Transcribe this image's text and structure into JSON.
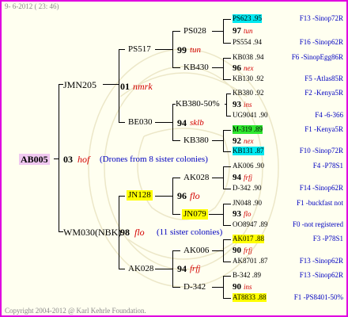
{
  "header": {
    "date": "9-  6-2012 ( 23: 46)"
  },
  "footer": {
    "copyright": "Copyright 2004-2012 @ Karl Kehrle Foundation."
  },
  "root": {
    "id": "AB005",
    "num": "03",
    "breed": "hof",
    "note": "(Drones from 8 sister colonies)"
  },
  "gen1": [
    {
      "id": "JMN205"
    },
    {
      "id": "WM030(NBK)",
      "num": "98",
      "breed": "flo",
      "note": "(11 sister colonies)"
    }
  ],
  "gen2": [
    {
      "id": "PS517"
    },
    {
      "num": "01",
      "breed": "nmrk"
    },
    {
      "id": "BE030"
    },
    {
      "id": "JN128"
    },
    {
      "num": "96",
      "breed": "flo"
    },
    {
      "id": "AK028"
    }
  ],
  "gen3": [
    {
      "id": "PS028"
    },
    {
      "num": "99",
      "breed": "tun"
    },
    {
      "id": "KB430"
    },
    {
      "id": "KB380-50%"
    },
    {
      "num": "94",
      "breed": "sklb"
    },
    {
      "id": "KB380"
    },
    {
      "id": "AK028"
    },
    {
      "num": "96",
      "breed": "flo"
    },
    {
      "id": "JN079"
    },
    {
      "id": "AK006"
    },
    {
      "num": "94",
      "breed": "frfj"
    },
    {
      "id": "D-342"
    }
  ],
  "gen4": [
    {
      "id": "PS623 .95",
      "sinop": "F13 -Sinop72R"
    },
    {
      "num": "97",
      "breed": "tun"
    },
    {
      "id": "PS554 .94",
      "sinop": "F16 -Sinop62R"
    },
    {
      "id": "KB038 .94",
      "sinop": "F6 -SinopEgg86R"
    },
    {
      "num": "96",
      "breed": "nex"
    },
    {
      "id": "KB130 .92",
      "sinop": "F5 -Atlas85R"
    },
    {
      "id": "KB380 .92",
      "sinop": "F2 -Kenya5R"
    },
    {
      "num": "93",
      "breed": "ins"
    },
    {
      "id": "UG9041 .90",
      "sinop": "F4 -6-366"
    },
    {
      "id": "M-319 .89",
      "sinop": "F1 -Kenya5R"
    },
    {
      "num": "92",
      "breed": "nex"
    },
    {
      "id": "KB131 .87",
      "sinop": "F10 -Sinop72R"
    },
    {
      "id": "AK006 .90",
      "sinop": "F4 -P78S1"
    },
    {
      "num": "94",
      "breed": "frfj"
    },
    {
      "id": "D-342 .90",
      "sinop": "F14 -Sinop62R"
    },
    {
      "id": "JN048 .90",
      "sinop": "F1 -buckfast not"
    },
    {
      "num": "93",
      "breed": "flo"
    },
    {
      "id": "OO8947 .89",
      "sinop": "F0 -not registered"
    },
    {
      "id": "AK017 .88",
      "sinop": "F3 -P78S1"
    },
    {
      "num": "90",
      "breed": "frfj"
    },
    {
      "id": "AK8701 .87",
      "sinop": "F13 -Sinop62R"
    },
    {
      "id": "B-342 .89",
      "sinop": "F13 -Sinop62R"
    },
    {
      "num": "90",
      "breed": "ins"
    },
    {
      "id": "AT8833 .88",
      "sinop": "F1 -PS8401-50%"
    }
  ]
}
